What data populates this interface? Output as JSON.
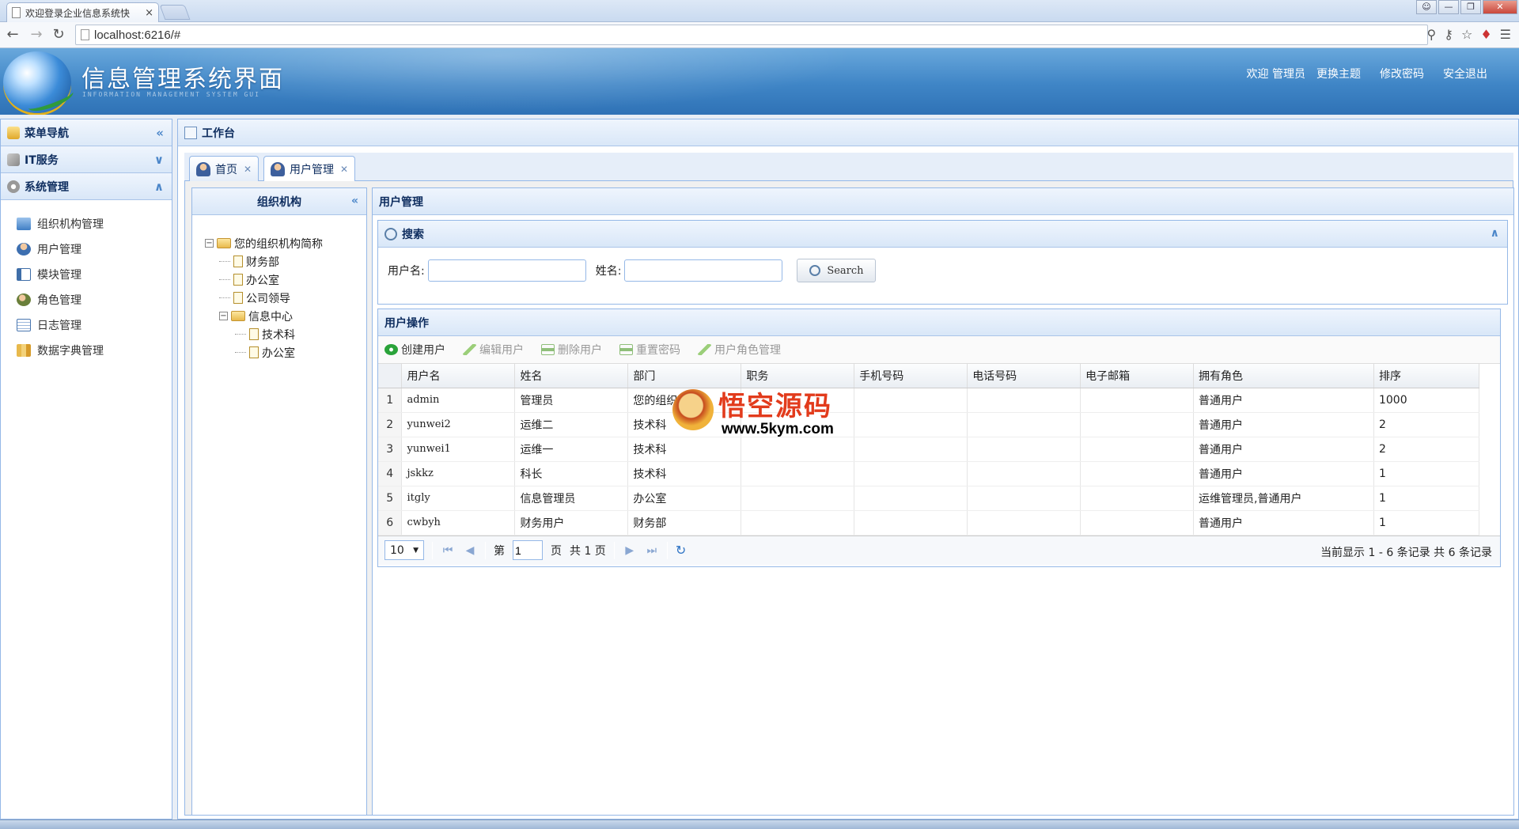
{
  "browser": {
    "tab_title": "欢迎登录企业信息系统快",
    "tab_close": "×",
    "url": "localhost:6216/#"
  },
  "header": {
    "title": "信息管理系统界面",
    "subtitle": "INFORMATION MANAGEMENT SYSTEM GUI",
    "welcome": "欢迎 管理员",
    "change_theme": "更换主题",
    "change_password": "修改密码",
    "logout": "安全退出"
  },
  "leftnav": {
    "title": "菜单导航",
    "groups": [
      {
        "label": "IT服务"
      },
      {
        "label": "系统管理"
      }
    ],
    "items": [
      {
        "label": "组织机构管理",
        "icon": "org-chart-icon"
      },
      {
        "label": "用户管理",
        "icon": "user-icon"
      },
      {
        "label": "模块管理",
        "icon": "module-icon"
      },
      {
        "label": "角色管理",
        "icon": "role-icon"
      },
      {
        "label": "日志管理",
        "icon": "log-icon"
      },
      {
        "label": "数据字典管理",
        "icon": "dictionary-icon"
      }
    ]
  },
  "main": {
    "title": "工作台",
    "tabs": [
      {
        "label": "首页"
      },
      {
        "label": "用户管理"
      }
    ]
  },
  "org": {
    "title": "组织机构",
    "root": "您的组织机构简称",
    "children": [
      "财务部",
      "办公室",
      "公司领导",
      "信息中心"
    ],
    "info_center_children": [
      "技术科",
      "办公室"
    ]
  },
  "users": {
    "title": "用户管理",
    "search": {
      "title": "搜索",
      "username_label": "用户名:",
      "name_label": "姓名:",
      "button": "Search"
    },
    "grid": {
      "title": "用户操作",
      "toolbar": [
        "创建用户",
        "编辑用户",
        "删除用户",
        "重置密码",
        "用户角色管理"
      ],
      "columns": [
        "用户名",
        "姓名",
        "部门",
        "职务",
        "手机号码",
        "电话号码",
        "电子邮箱",
        "拥有角色",
        "排序"
      ],
      "rows": [
        {
          "n": "1",
          "username": "admin",
          "name": "管理员",
          "dept": "您的组织",
          "role": "普通用户",
          "sort": "1000"
        },
        {
          "n": "2",
          "username": "yunwei2",
          "name": "运维二",
          "dept": "技术科",
          "role": "普通用户",
          "sort": "2"
        },
        {
          "n": "3",
          "username": "yunwei1",
          "name": "运维一",
          "dept": "技术科",
          "role": "普通用户",
          "sort": "2"
        },
        {
          "n": "4",
          "username": "jskkz",
          "name": "科长",
          "dept": "技术科",
          "role": "普通用户",
          "sort": "1"
        },
        {
          "n": "5",
          "username": "itgly",
          "name": "信息管理员",
          "dept": "办公室",
          "role": "运维管理员,普通用户",
          "sort": "1"
        },
        {
          "n": "6",
          "username": "cwbyh",
          "name": "财务用户",
          "dept": "财务部",
          "role": "普通用户",
          "sort": "1"
        }
      ]
    },
    "pager": {
      "page_size": "10",
      "page_prefix": "第",
      "page_value": "1",
      "page_suffix": "页",
      "total_pages": "共 1 页",
      "info": "当前显示 1 - 6 条记录  共 6 条记录"
    }
  },
  "watermark": {
    "title": "悟空源码",
    "url": "www.5kym.com"
  },
  "colors": {
    "header_blue": "#3f85c6",
    "panel_border": "#95b8e7",
    "panel_title": "#0e2d5f"
  }
}
